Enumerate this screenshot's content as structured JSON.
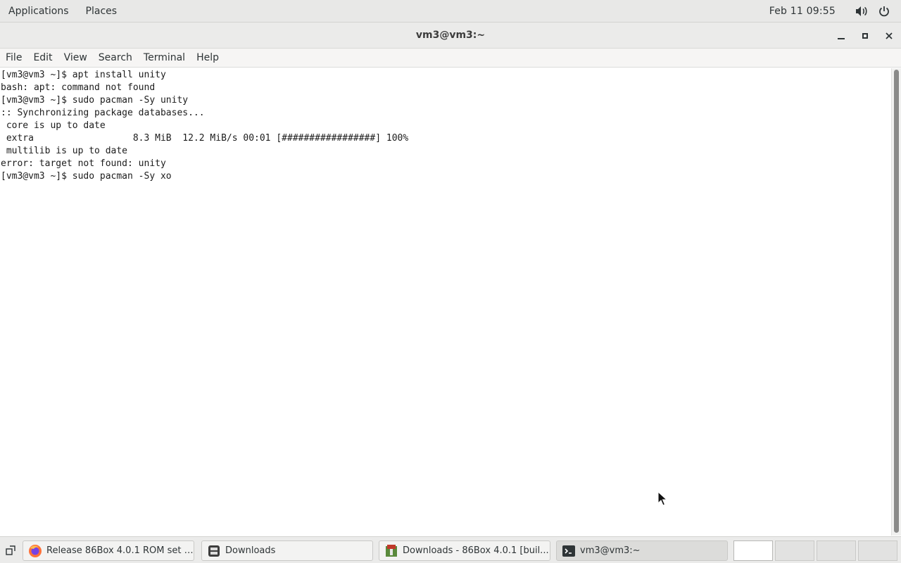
{
  "top_panel": {
    "applications_label": "Applications",
    "places_label": "Places",
    "clock": "Feb 11  09:55",
    "volume_icon": "volume-icon",
    "power_icon": "power-icon"
  },
  "window": {
    "title": "vm3@vm3:~",
    "controls": [
      "minimize-icon",
      "maximize-icon",
      "close-icon"
    ]
  },
  "menubar": {
    "items": [
      "File",
      "Edit",
      "View",
      "Search",
      "Terminal",
      "Help"
    ]
  },
  "terminal": {
    "lines": [
      "[vm3@vm3 ~]$ apt install unity",
      "bash: apt: command not found",
      "[vm3@vm3 ~]$ sudo pacman -Sy unity",
      ":: Synchronizing package databases...",
      " core is up to date",
      " extra                  8.3 MiB  12.2 MiB/s 00:01 [#################] 100%",
      " multilib is up to date",
      "error: target not found: unity",
      "[vm3@vm3 ~]$ sudo pacman -Sy xo"
    ]
  },
  "taskbar": {
    "tasks": [
      {
        "label": "Release 86Box 4.0.1 ROM set · ...",
        "icon": "firefox-icon"
      },
      {
        "label": "Downloads",
        "icon": "file-manager-icon"
      },
      {
        "label": "Downloads - 86Box 4.0.1 [buil...",
        "icon": "archive-manager-icon"
      },
      {
        "label": "vm3@vm3:~",
        "icon": "terminal-icon"
      }
    ],
    "workspaces": 4,
    "current_workspace": 1
  }
}
